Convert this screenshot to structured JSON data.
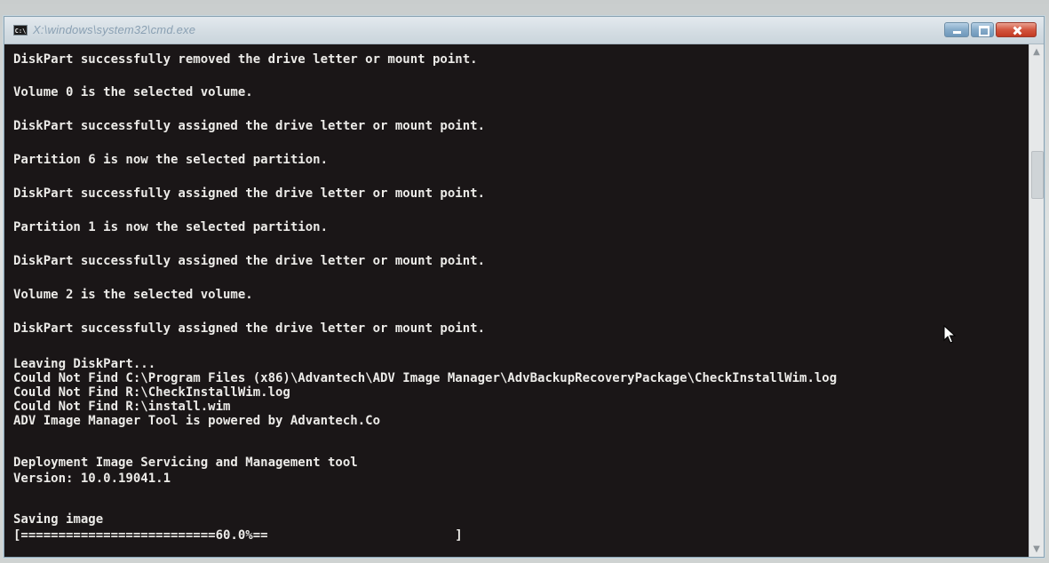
{
  "window": {
    "title": "X:\\windows\\system32\\cmd.exe",
    "icon_label": "C:\\"
  },
  "console": {
    "lines": [
      "DiskPart successfully removed the drive letter or mount point.",
      "Volume 0 is the selected volume.",
      "DiskPart successfully assigned the drive letter or mount point.",
      "Partition 6 is now the selected partition.",
      "DiskPart successfully assigned the drive letter or mount point.",
      "Partition 1 is now the selected partition.",
      "DiskPart successfully assigned the drive letter or mount point.",
      "Volume 2 is the selected volume.",
      "DiskPart successfully assigned the drive letter or mount point.",
      "Leaving DiskPart...",
      "Could Not Find C:\\Program Files (x86)\\Advantech\\ADV Image Manager\\AdvBackupRecoveryPackage\\CheckInstallWim.log",
      "Could Not Find R:\\CheckInstallWim.log",
      "Could Not Find R:\\install.wim",
      "ADV Image Manager Tool is powered by Advantech.Co",
      "Deployment Image Servicing and Management tool",
      "Version: 10.0.19041.1",
      "Saving image",
      "[==========================60.0%==                         ]"
    ]
  },
  "progress": {
    "percent": 60.0
  },
  "scrollbar": {
    "up_glyph": "▲",
    "down_glyph": "▼"
  }
}
